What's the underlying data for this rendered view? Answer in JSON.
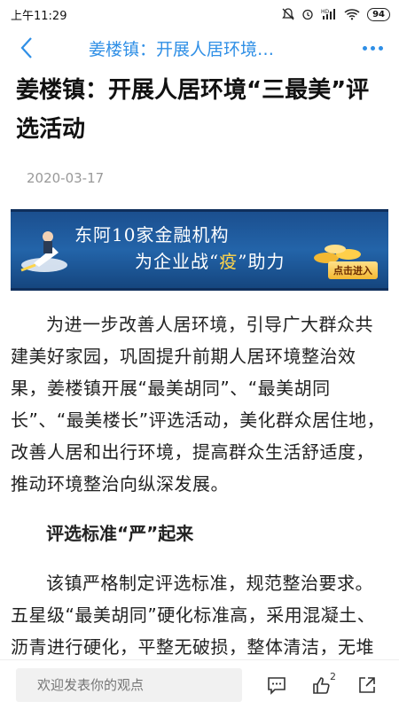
{
  "status_bar": {
    "time": "上午11:29",
    "battery": "94"
  },
  "nav": {
    "title": "姜楼镇：开展人居环境…",
    "back_icon": "chevron-left-icon",
    "more_icon": "more-dots-icon"
  },
  "article": {
    "title": "姜楼镇：开展人居环境“三最美”评选活动",
    "date": "2020-03-17",
    "banner": {
      "line1": "东阿10家金融机构",
      "line2_pre": "为企业战“",
      "line2_hl": "疫",
      "line2_post": "”助力",
      "cta": "点击进入"
    },
    "paragraph1": "为进一步改善人居环境，引导广大群众共建美好家园，巩固提升前期人居环境整治效果，姜楼镇开展“最美胡同”、“最美胡同长”、“最美楼长”评选活动，美化群众居住地，改善人居和出行环境，提高群众生活舒适度，推动环境整治向纵深发展。",
    "subhead": "评选标准“严”起来",
    "paragraph2": "该镇严格制定评选标准，规范整治要求。五星级“最美胡同”硬化标准高，采用混凝土、沥青进行硬化，平整无破损，整体清洁，无堆"
  },
  "bottom_bar": {
    "comment_placeholder": "欢迎发表你的观点",
    "like_count": "2"
  },
  "colors": {
    "accent": "#2f8fe6",
    "banner_bg": "#1b4f8f"
  }
}
